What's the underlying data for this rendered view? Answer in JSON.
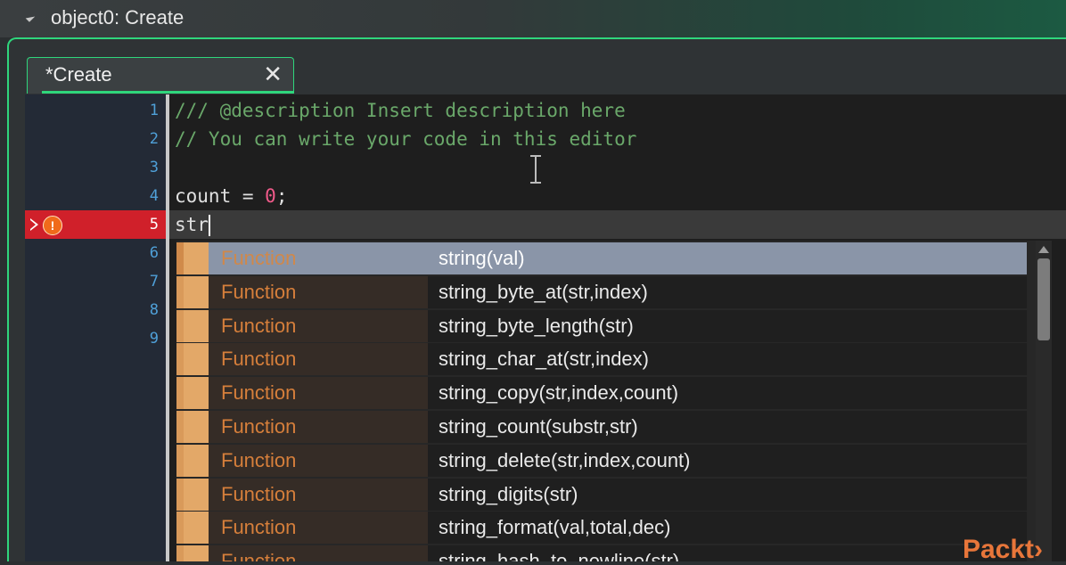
{
  "window": {
    "title": "object0: Create"
  },
  "tab": {
    "label": "*Create",
    "close_glyph": "✕"
  },
  "editor": {
    "line_numbers": [
      "1",
      "2",
      "3",
      "4",
      "5",
      "6",
      "7",
      "8",
      "9"
    ],
    "error_line": "5",
    "code": {
      "line1": "/// @description Insert description here",
      "line2": "// You can write your code in this editor",
      "line4_text": "count = ",
      "line4_num": "0",
      "line4_end": ";",
      "line5": "str"
    }
  },
  "autocomplete": {
    "items": [
      {
        "kind": "Function",
        "name": "string(val)"
      },
      {
        "kind": "Function",
        "name": "string_byte_at(str,index)"
      },
      {
        "kind": "Function",
        "name": "string_byte_length(str)"
      },
      {
        "kind": "Function",
        "name": "string_char_at(str,index)"
      },
      {
        "kind": "Function",
        "name": "string_copy(str,index,count)"
      },
      {
        "kind": "Function",
        "name": "string_count(substr,str)"
      },
      {
        "kind": "Function",
        "name": "string_delete(str,index,count)"
      },
      {
        "kind": "Function",
        "name": "string_digits(str)"
      },
      {
        "kind": "Function",
        "name": "string_format(val,total,dec)"
      },
      {
        "kind": "Function",
        "name": "string_hash_to_newline(str)"
      }
    ],
    "selected_index": 0
  },
  "watermark": {
    "text": "Packt›"
  },
  "colors": {
    "accent": "#2fd67c",
    "error": "#d0202a",
    "kind_text": "#d67f3b"
  }
}
